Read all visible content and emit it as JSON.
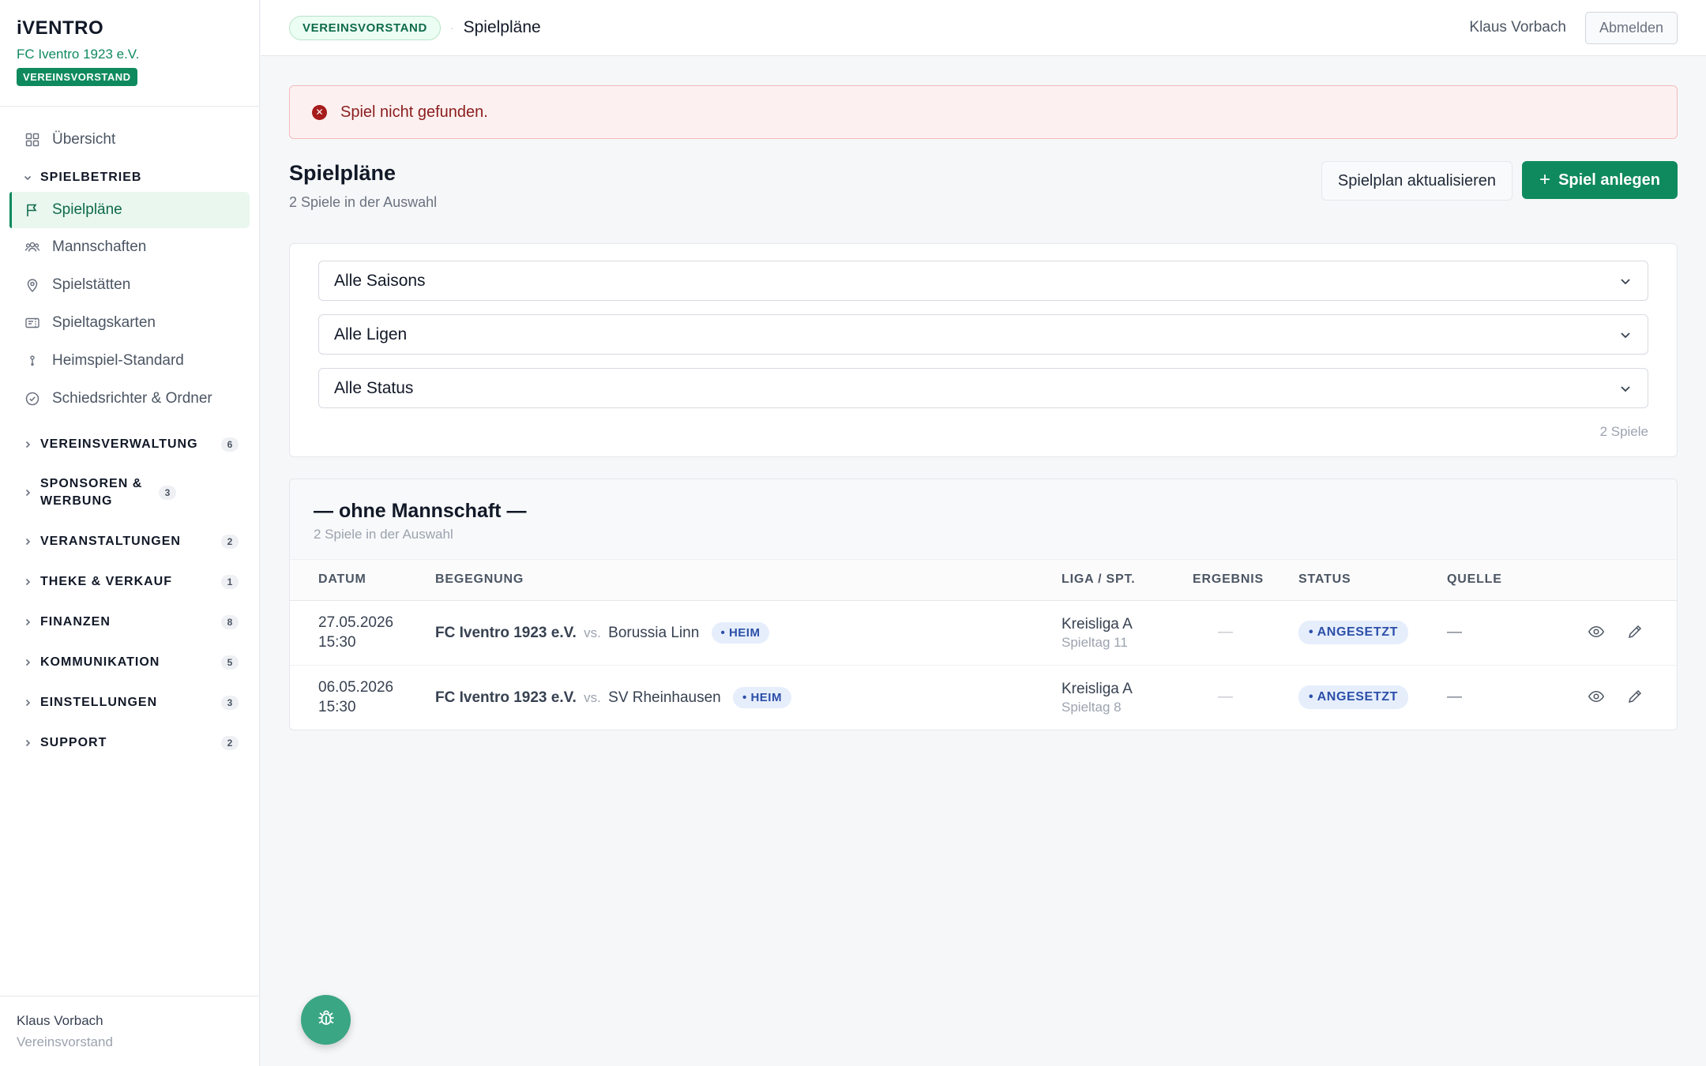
{
  "brand": {
    "logo": "iVENTRO",
    "club": "FC Iventro 1923 e.V.",
    "role": "VEREINSVORSTAND"
  },
  "nav": {
    "overview": "Übersicht",
    "spielbetrieb": {
      "label": "SPIELBETRIEB",
      "items": [
        "Spielpläne",
        "Mannschaften",
        "Spielstätten",
        "Spieltagskarten",
        "Heimspiel-Standard",
        "Schiedsrichter & Ordner"
      ]
    },
    "groups": [
      {
        "label": "VEREINSVERWALTUNG",
        "count": "6"
      },
      {
        "label": "SPONSOREN & WERBUNG",
        "count": "3"
      },
      {
        "label": "VERANSTALTUNGEN",
        "count": "2"
      },
      {
        "label": "THEKE & VERKAUF",
        "count": "1"
      },
      {
        "label": "FINANZEN",
        "count": "8"
      },
      {
        "label": "KOMMUNIKATION",
        "count": "5"
      },
      {
        "label": "EINSTELLUNGEN",
        "count": "3"
      },
      {
        "label": "SUPPORT",
        "count": "2"
      }
    ]
  },
  "sidebar_footer": {
    "name": "Klaus Vorbach",
    "role": "Vereinsvorstand"
  },
  "topbar": {
    "badge": "VEREINSVORSTAND",
    "page": "Spielpläne",
    "user": "Klaus Vorbach",
    "logout": "Abmelden"
  },
  "alert": {
    "text": "Spiel nicht gefunden."
  },
  "header": {
    "title": "Spielpläne",
    "subtitle": "2 Spiele in der Auswahl",
    "refresh": "Spielplan aktualisieren",
    "create": "Spiel anlegen"
  },
  "filters": {
    "season": "Alle Saisons",
    "league": "Alle Ligen",
    "status": "Alle Status",
    "count": "2 Spiele"
  },
  "group_card": {
    "title": "— ohne Mannschaft —",
    "subtitle": "2 Spiele in der Auswahl",
    "columns": [
      "DATUM",
      "BEGEGNUNG",
      "LIGA / SPT.",
      "ERGEBNIS",
      "STATUS",
      "QUELLE"
    ],
    "rows": [
      {
        "date": "27.05.2026",
        "time": "15:30",
        "home": "FC Iventro 1923 e.V.",
        "vs": "vs.",
        "away": "Borussia Linn",
        "tag": "• HEIM",
        "league": "Kreisliga A",
        "matchday": "Spieltag 11",
        "result": "—",
        "status": "• ANGESETZT",
        "source": "—"
      },
      {
        "date": "06.05.2026",
        "time": "15:30",
        "home": "FC Iventro 1923 e.V.",
        "vs": "vs.",
        "away": "SV Rheinhausen",
        "tag": "• HEIM",
        "league": "Kreisliga A",
        "matchday": "Spieltag 8",
        "result": "—",
        "status": "• ANGESETZT",
        "source": "—"
      }
    ]
  },
  "icons": {
    "fab": "bug-icon"
  },
  "colors": {
    "accent": "#0f8a5f",
    "alert_bg": "#fdf0f0",
    "alert_text": "#8b1d1d",
    "status_blue": "#2c4fa8"
  }
}
